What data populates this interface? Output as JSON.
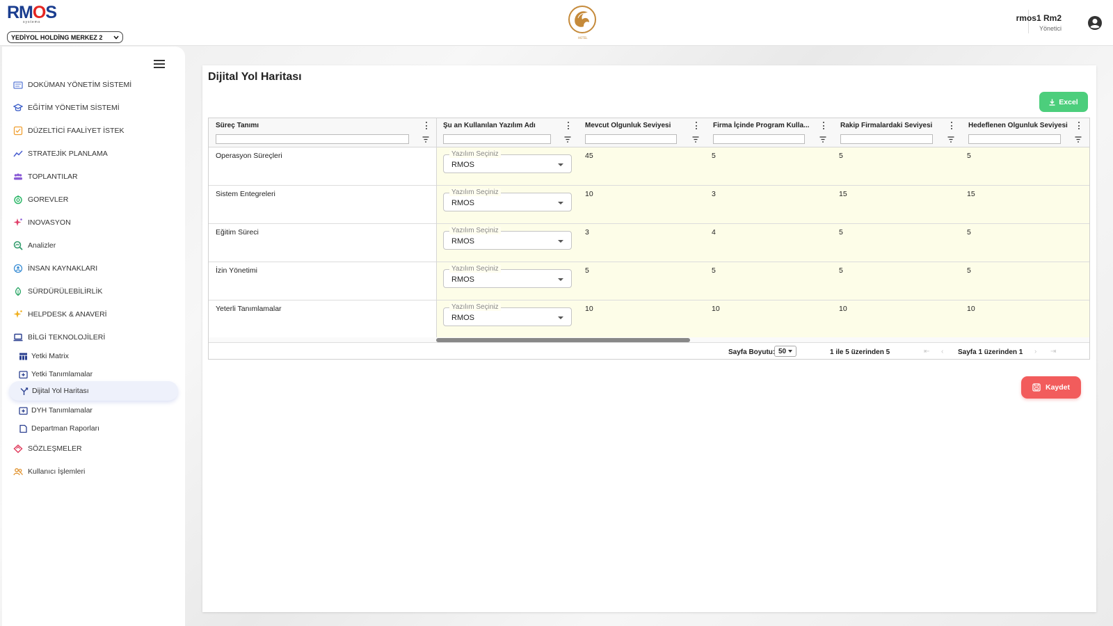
{
  "header": {
    "logo_main_1": "RM",
    "logo_main_2": "O",
    "logo_main_3": "S",
    "logo_sub": "systems",
    "company": "YEDİYOL HOLDİNG MERKEZ 2",
    "user_name": "rmos1 Rm2",
    "user_role": "Yönetici"
  },
  "sidebar": {
    "items": [
      {
        "label": "DOKÜMAN YÖNETİM SİSTEMİ",
        "icon": "folder-icon",
        "color": "#5b7bd5"
      },
      {
        "label": "EĞİTİM YÖNETİM SİSTEMİ",
        "icon": "graduation-cap-icon",
        "color": "#3d5fc8"
      },
      {
        "label": "DÜZELTİCİ FAALİYET İSTEK",
        "icon": "checkbox-icon",
        "color": "#f0a032"
      },
      {
        "label": "STRATEJİK PLANLAMA",
        "icon": "trend-line-icon",
        "color": "#4a5fd0"
      },
      {
        "label": "TOPLANTILAR",
        "icon": "people-group-icon",
        "color": "#8a5bd5"
      },
      {
        "label": "GOREVLER",
        "icon": "power-icon",
        "color": "#2fb86a"
      },
      {
        "label": "INOVASYON",
        "icon": "sparkle-icon",
        "color": "#e0406a"
      },
      {
        "label": "Analizler",
        "icon": "analytics-icon",
        "color": "#2f9a6a"
      },
      {
        "label": "İNSAN KAYNAKLARI",
        "icon": "hr-icon",
        "color": "#3d8fd5"
      },
      {
        "label": "SÜRDÜRÜLEBİLİRLİK",
        "icon": "leaf-icon",
        "color": "#2fa86a"
      },
      {
        "label": "HELPDESK & ANAVERİ",
        "icon": "sparkle-icon",
        "color": "#f0b020"
      },
      {
        "label": "BİLGİ TEKNOLOJİLERİ",
        "icon": "laptop-icon",
        "color": "#2a3f8f"
      },
      {
        "label": "SÖZLEŞMELER",
        "icon": "handshake-icon",
        "color": "#e04060"
      },
      {
        "label": "Kullanıcı İşlemleri",
        "icon": "users-icon",
        "color": "#e0902a"
      }
    ],
    "sub_items": [
      {
        "label": "Yetki Matrix",
        "icon": "grid-icon"
      },
      {
        "label": "Yetki Tanımlamalar",
        "icon": "add-box-icon"
      },
      {
        "label": "Dijital Yol Haritası",
        "icon": "route-icon"
      },
      {
        "label": "DYH Tanımlamalar",
        "icon": "add-box-icon"
      },
      {
        "label": "Departman Raporları",
        "icon": "document-icon"
      }
    ],
    "active_sub": "Dijital Yol Haritası"
  },
  "main": {
    "title": "Dijital Yol Haritası",
    "excel_label": "Excel",
    "save_label": "Kaydet",
    "columns": [
      "Süreç Tanımı",
      "Şu an Kullanılan Yazılım Adı",
      "Mevcut Olgunluk Seviyesi",
      "Firma İçinde Program Kulla...",
      "Rakip Firmalardaki Seviyesi",
      "Hedeflenen Olgunluk Seviyesi"
    ],
    "select_label": "Yazılım Seçiniz",
    "rows": [
      {
        "process": "Operasyon Süreçleri",
        "software": "RMOS",
        "current": "45",
        "internal": "5",
        "competitor": "5",
        "target": "5"
      },
      {
        "process": "Sistem Entegreleri",
        "software": "RMOS",
        "current": "10",
        "internal": "3",
        "competitor": "15",
        "target": "15"
      },
      {
        "process": "Eğitim Süreci",
        "software": "RMOS",
        "current": "3",
        "internal": "4",
        "competitor": "5",
        "target": "5"
      },
      {
        "process": "İzin Yönetimi",
        "software": "RMOS",
        "current": "5",
        "internal": "5",
        "competitor": "5",
        "target": "5"
      },
      {
        "process": "Yeterli Tanımlamalar",
        "software": "RMOS",
        "current": "10",
        "internal": "10",
        "competitor": "10",
        "target": "10"
      }
    ],
    "pager": {
      "size_label": "Sayfa Boyutu:",
      "size_value": "50",
      "range": "1 ile 5 üzerinden 5",
      "page": "Sayfa 1 üzerinden 1"
    }
  },
  "colors": {
    "excel": "#4cce7c",
    "save": "#f25c5c",
    "brand_blue": "#1a3d8f",
    "brand_red": "#e52521",
    "row_tint": "#fdfde8"
  }
}
